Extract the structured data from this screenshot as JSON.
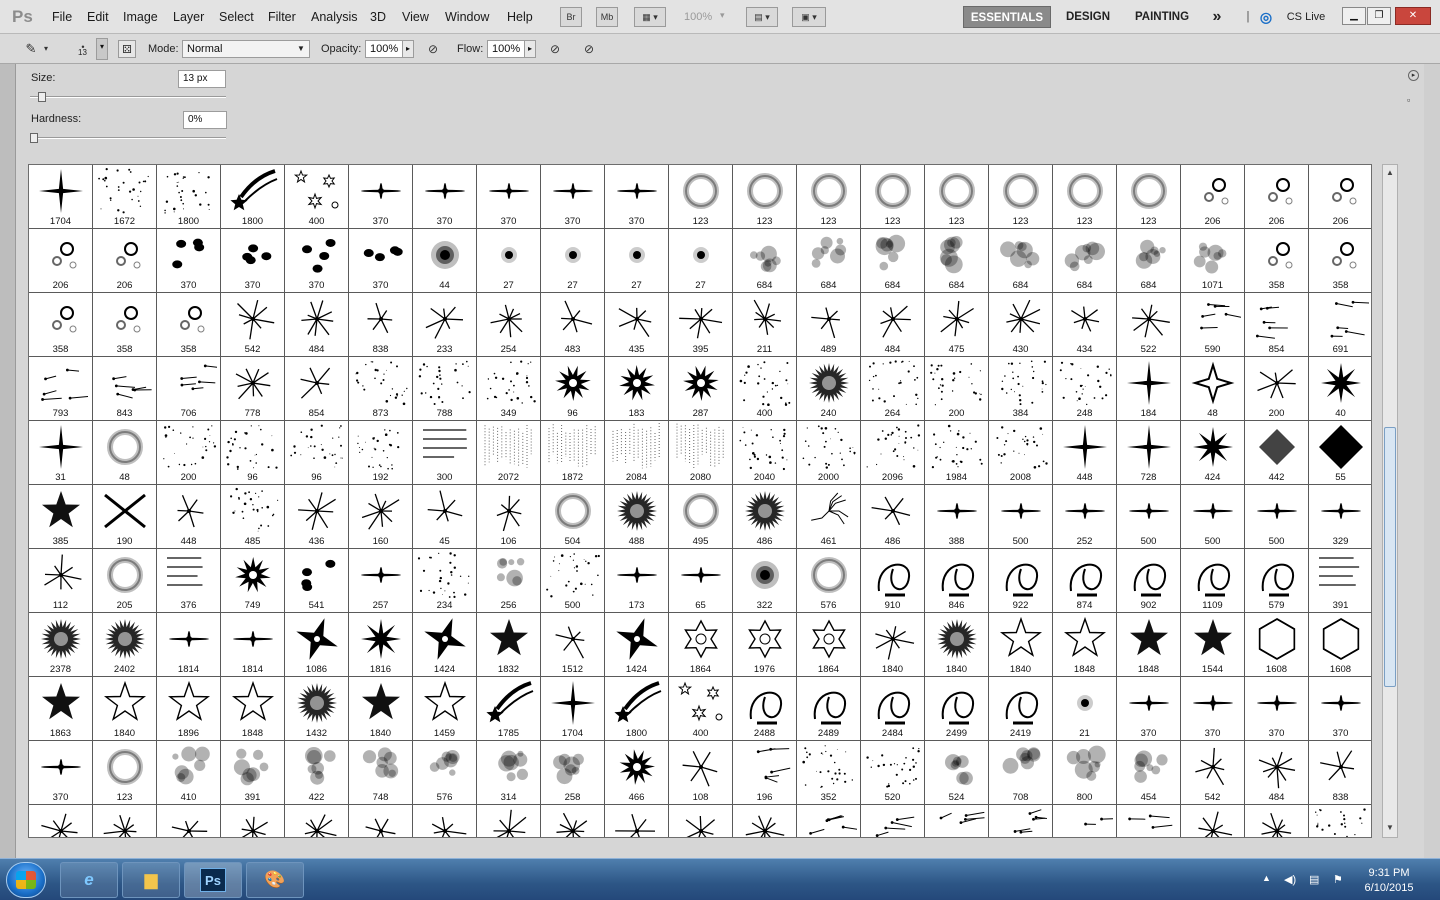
{
  "app": {
    "logo": "Ps"
  },
  "menu": [
    "File",
    "Edit",
    "Image",
    "Layer",
    "Select",
    "Filter",
    "Analysis",
    "3D",
    "View",
    "Window",
    "Help"
  ],
  "menubar_buttons": {
    "bridge": "Br",
    "mini_bridge": "Mb",
    "zoom": "100%"
  },
  "workspaces": {
    "essentials": "ESSENTIALS",
    "design": "DESIGN",
    "painting": "PAINTING",
    "more": "»",
    "cs_live": "CS Live"
  },
  "options": {
    "mode_label": "Mode:",
    "mode_value": "Normal",
    "opacity_label": "Opacity:",
    "opacity_value": "100%",
    "flow_label": "Flow:",
    "flow_value": "100%",
    "brush_size_small": "13"
  },
  "brush_panel": {
    "size_label": "Size:",
    "size_value": "13 px",
    "size_fraction": 0.04,
    "hardness_label": "Hardness:",
    "hardness_value": "0%",
    "hardness_fraction": 0.0
  },
  "presets": [
    [
      "star4:1704",
      "dots:1672",
      "dots:1800",
      "comet:1800",
      "scatter:400",
      "flare:370",
      "flare:370",
      "flare:370",
      "flare:370",
      "flare:370",
      "ring:123",
      "ring:123",
      "ring:123",
      "ring:123",
      "ring:123",
      "ring:123",
      "ring:123",
      "ring:123",
      "bubbles:206",
      "bubbles:206",
      "bubbles:206"
    ],
    [
      "bubbles:206",
      "bubbles:206",
      "blobs:370",
      "blobs:370",
      "blobs:370",
      "blobs:370",
      "soft:44",
      "dot:27",
      "dot:27",
      "dot:27",
      "dot:27",
      "cloud:684",
      "cloud:684",
      "cloud:684",
      "cloud:684",
      "cloud:684",
      "cloud:684",
      "cloud:684",
      "cloud:1071",
      "bubbles:358",
      "bubbles:358"
    ],
    [
      "bubbles:358",
      "bubbles:358",
      "bubbles:358",
      "burst:542",
      "burst:484",
      "burst:838",
      "burst:233",
      "burst:254",
      "burst:483",
      "burst:435",
      "burst:395",
      "burst:211",
      "burst:489",
      "burst:484",
      "burst:475",
      "burst:430",
      "burst:434",
      "burst:522",
      "cross:590",
      "cross:854",
      "cross:691"
    ],
    [
      "cross:793",
      "cross:843",
      "cross:706",
      "burst:778",
      "burst:854",
      "dots:873",
      "dots:788",
      "dots:349",
      "splat:96",
      "splat:183",
      "splat:287",
      "dots:400",
      "spiky:240",
      "dots:264",
      "dots:200",
      "dots:384",
      "dots:248",
      "star4:184",
      "star4o:48",
      "burst:200",
      "star8:40"
    ],
    [
      "star4:31",
      "ring:48",
      "dots:200",
      "dots:96",
      "dots:96",
      "dots:192",
      "text:300",
      "rain:2072",
      "rain:1872",
      "rain:2084",
      "rain:2080",
      "dots:2040",
      "dots:2000",
      "dots:2096",
      "dots:1984",
      "dots:2008",
      "star4:448",
      "star4:728",
      "star8:424",
      "diamondsoft:442",
      "diamond:55"
    ],
    [
      "star5:385",
      "xcross:190",
      "burst:448",
      "dots:485",
      "burst:436",
      "burst:160",
      "burst:45",
      "burst:106",
      "ring:504",
      "spiky:488",
      "ring:495",
      "spiky:486",
      "crack:461",
      "burst:486",
      "flare:388",
      "flare:500",
      "flare:252",
      "flare:500",
      "flare:500",
      "flare:500",
      "flare:329"
    ],
    [
      "burst:112",
      "ring:205",
      "text:376",
      "splat:749",
      "blobs:541",
      "flare:257",
      "dots:234",
      "cloud:256",
      "dots:500",
      "flare:173",
      "flare:65",
      "soft:322",
      "ring:576",
      "swirl:910",
      "swirl:846",
      "swirl:922",
      "swirl:874",
      "swirl:902",
      "swirl:1109",
      "swirl:579",
      "text:391"
    ],
    [
      "spiky:2378",
      "spiky:2402",
      "flare:1814",
      "flare:1814",
      "shuriken:1086",
      "star8:1816",
      "shuriken:1424",
      "star5:1832",
      "burst:1512",
      "shuriken:1424",
      "star6o:1864",
      "star6o:1976",
      "star6o:1864",
      "burst:1840",
      "spiky:1840",
      "star5o:1840",
      "star5o:1848",
      "star5:1848",
      "star5:1544",
      "hexagram:1608",
      "hexagram:1608"
    ],
    [
      "star5:1863",
      "star5o:1840",
      "star5o:1896",
      "star5o:1848",
      "spiky:1432",
      "star5:1840",
      "star5o:1459",
      "comet:1785",
      "star4:1704",
      "comet:1800",
      "scatter:400",
      "swirl:2488",
      "swirl:2489",
      "swirl:2484",
      "swirl:2499",
      "swirl:2419",
      "dot:21",
      "flare:370",
      "flare:370",
      "flare:370",
      "flare:370"
    ],
    [
      "flare:370",
      "ring:123",
      "cloud:410",
      "cloud:391",
      "cloud:422",
      "cloud:748",
      "cloud:576",
      "cloud:314",
      "cloud:258",
      "splat:466",
      "burst:108",
      "cross:196",
      "dots:352",
      "dots:520",
      "cloud:524",
      "cloud:708",
      "cloud:800",
      "cloud:454",
      "burst:542",
      "burst:484",
      "burst:838"
    ],
    [
      "burst:",
      "burst:",
      "burst:",
      "burst:",
      "burst:",
      "burst:",
      "burst:",
      "burst:",
      "burst:",
      "burst:",
      "burst:",
      "burst:",
      "cross:",
      "cross:",
      "cross:",
      "cross:",
      "cross:",
      "cross:",
      "burst:",
      "burst:",
      "dots:"
    ]
  ],
  "taskbar": {
    "time": "9:31 PM",
    "date": "6/10/2015",
    "apps": [
      "ie",
      "explorer",
      "photoshop",
      "paint"
    ]
  },
  "colors": {
    "workspace_active": "#8a8a8a",
    "scroll_thumb": "#d8e6f3",
    "taskbar": "#2d5686"
  }
}
